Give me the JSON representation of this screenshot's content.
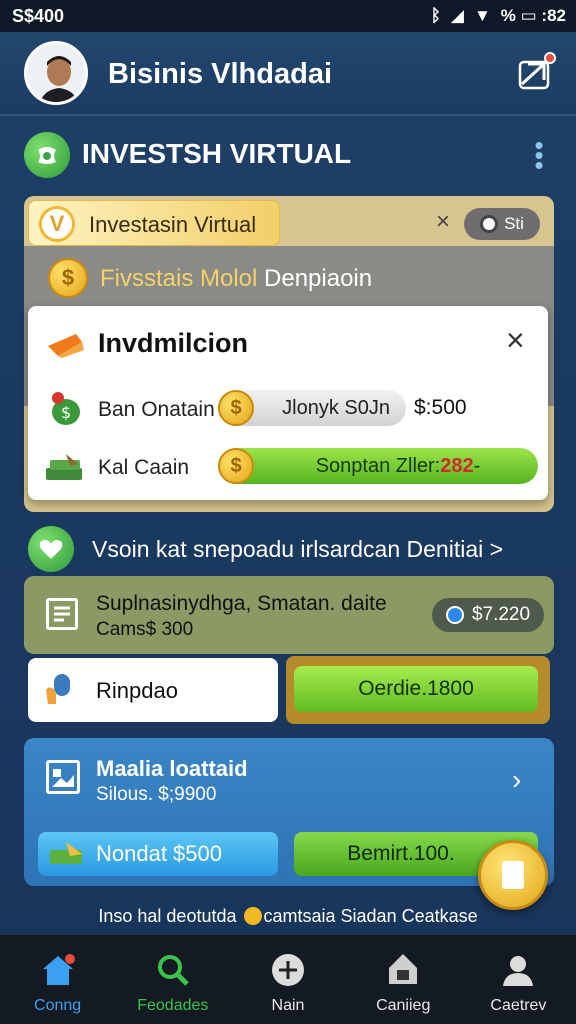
{
  "status_bar": {
    "left_text": "S$400",
    "right_text": "% ▭ :82",
    "bluetooth_icon": "ᛒ",
    "signal_icon": "◢",
    "wifi_icon": "▼"
  },
  "header": {
    "title": "Bisinis Vlhdadai"
  },
  "section1": {
    "title": "INVESTSH VIRTUAL",
    "banner_label": "Investasin Virtual",
    "banner_v": "V",
    "close_glyph": "×",
    "pill_text": "Sti",
    "row_title_gold": "Fivsstais Molol ",
    "row_title_white": "Denpiaoin"
  },
  "modal": {
    "title": "Invdmilcion",
    "close_glyph": "×",
    "row1_label": "Ban Onatain",
    "row1_pill": "Jlonyk S0Jn",
    "row1_amount": "$:500",
    "row2_label": "Kal Caain",
    "row2_pill_text": "Sonptan Zller: ",
    "row2_pill_value": "282",
    "row2_pill_suffix": " -",
    "coin_symbol": "$"
  },
  "section2": {
    "title": "Vsoin kat snepoadu irlsardcan Denitiai >",
    "card_title": "Suplnasinydhga, Smatan. daite",
    "card_sub": "Cams$ 300",
    "price": "$7.220",
    "white_card_label": "Rinpdao",
    "green_btn": "Oerdie.1800"
  },
  "section3": {
    "title": "Maalia loattaid",
    "sub": "Silous. $;9900",
    "chevron": "›",
    "btn_blue": "Nondat $500",
    "btn_green": "Bemirt.100."
  },
  "footer_note": {
    "before": "Inso hal deotutda ",
    "after": "camtsaia Siadan Ceatkase"
  },
  "bottom_nav": [
    {
      "label": "Conng",
      "icon": "home-icon",
      "color": "#3aa0f0"
    },
    {
      "label": "Feodades",
      "icon": "search-icon",
      "color": "#3cc24a"
    },
    {
      "label": "Nain",
      "icon": "plus-icon",
      "color": "#e8e8e8"
    },
    {
      "label": "Caniieg",
      "icon": "shield-icon",
      "color": "#e8e8e8"
    },
    {
      "label": "Caetrev",
      "icon": "user-icon",
      "color": "#e8e8e8"
    }
  ]
}
